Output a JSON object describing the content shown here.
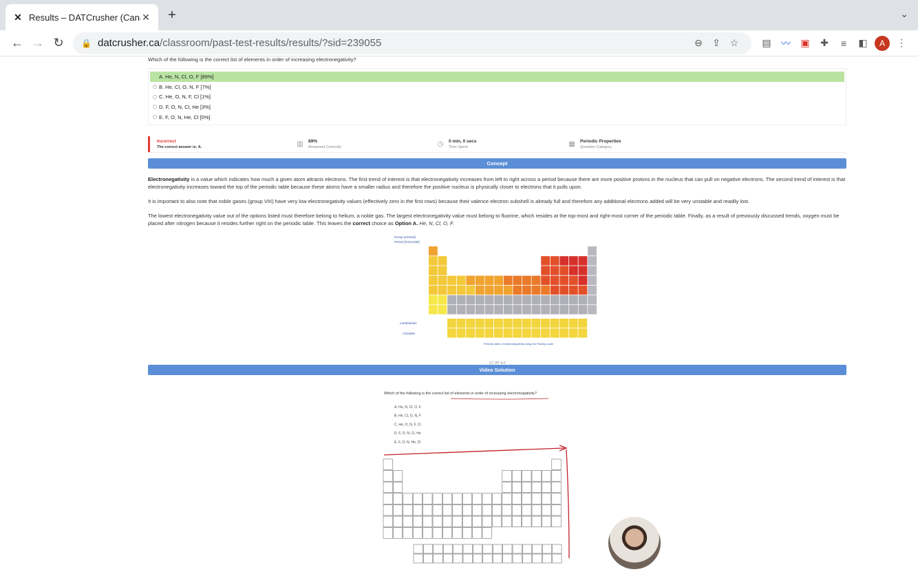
{
  "browser": {
    "tab_title": "Results – DATCrusher (Canadia",
    "url_host": "datcrusher.ca",
    "url_path": "/classroom/past-test-results/results/?sid=239055",
    "avatar_letter": "A"
  },
  "question": {
    "text": "Which of the following is the correct list of elements in order of increasing electronegativity?",
    "options": [
      {
        "label": "A. He, N, Cl, O, F [89%]",
        "correct": true
      },
      {
        "label": "B. He, Cl, O, N, F [7%]",
        "correct": false
      },
      {
        "label": "C. He, O, N, F, Cl [1%]",
        "correct": false
      },
      {
        "label": "D. F, O, N, Cl, He [3%]",
        "correct": false
      },
      {
        "label": "E. F, O, N, He, Cl [0%]",
        "correct": false
      }
    ]
  },
  "stats": {
    "result": "Incorrect",
    "correct_answer": "The correct answer is: A.",
    "percent": "89%",
    "percent_label": "Answered Correctly",
    "time": "0 min, 0 secs",
    "time_label": "Time Spent",
    "category": "Periodic Properties",
    "category_label": "Question Category"
  },
  "concept": {
    "heading": "Concept",
    "p1_bold": "Electronegativity",
    "p1": " is a value which indicates how much a given atom attracts electrons. The first trend of interest is that electronegativity increases from left to right across a period because there are more positive protons in the nucleus that can pull on negative electrons. The second trend of interest is that electronegativity increases toward the top of the periodic table because these atoms have a smaller radius and therefore the positive nucleus is physically closer to electrons that it pulls upon.",
    "p2": "It is important to also note that noble gases (group VIII) have very low electronegativity values (effectively zero in the first rows) because their valence electron subshell is already full and therefore any additional electrons added will be very unstable and readily lost.",
    "p3a": "The lowest electronegativity value out of the options listed must therefore belong to helium, a noble gas. The largest electronegativity value must belong to fluorine, which resides at the top-most and right-most corner of the periodic table. Finally, as a result of previously discussed trends, oxygen must be placed after nitrogen because it resides further right on the periodic table. This leaves the ",
    "p3_correct": "correct",
    "p3b": " choice as ",
    "p3_option": "Option A.",
    "p3_answer": " He, N, Cl, O, F.",
    "table_caption": "Periodic table of electronegativity using the Pauling scale",
    "table_group_label": "Group (vertical)",
    "table_period_label": "Period (horizontal)",
    "lanthanides": "Lanthanides",
    "actinides": "Actinides",
    "credit": "CC BY 4.0"
  },
  "video": {
    "heading": "Video Solution",
    "question": "Which of the following is the correct list of elements in order of increasing electronegativity?",
    "options": [
      "A. He, N, Cl, O, F",
      "B. He, Cl, O, N, F",
      "C. He, O, N, F, Cl",
      "D. F, O, N, Cl, He",
      "E. F, O, N, He, Cl"
    ]
  },
  "colors": {
    "accent_bar": "#5b8ed6",
    "correct_bg": "#b9e3a2",
    "incorrect": "#e53935"
  }
}
